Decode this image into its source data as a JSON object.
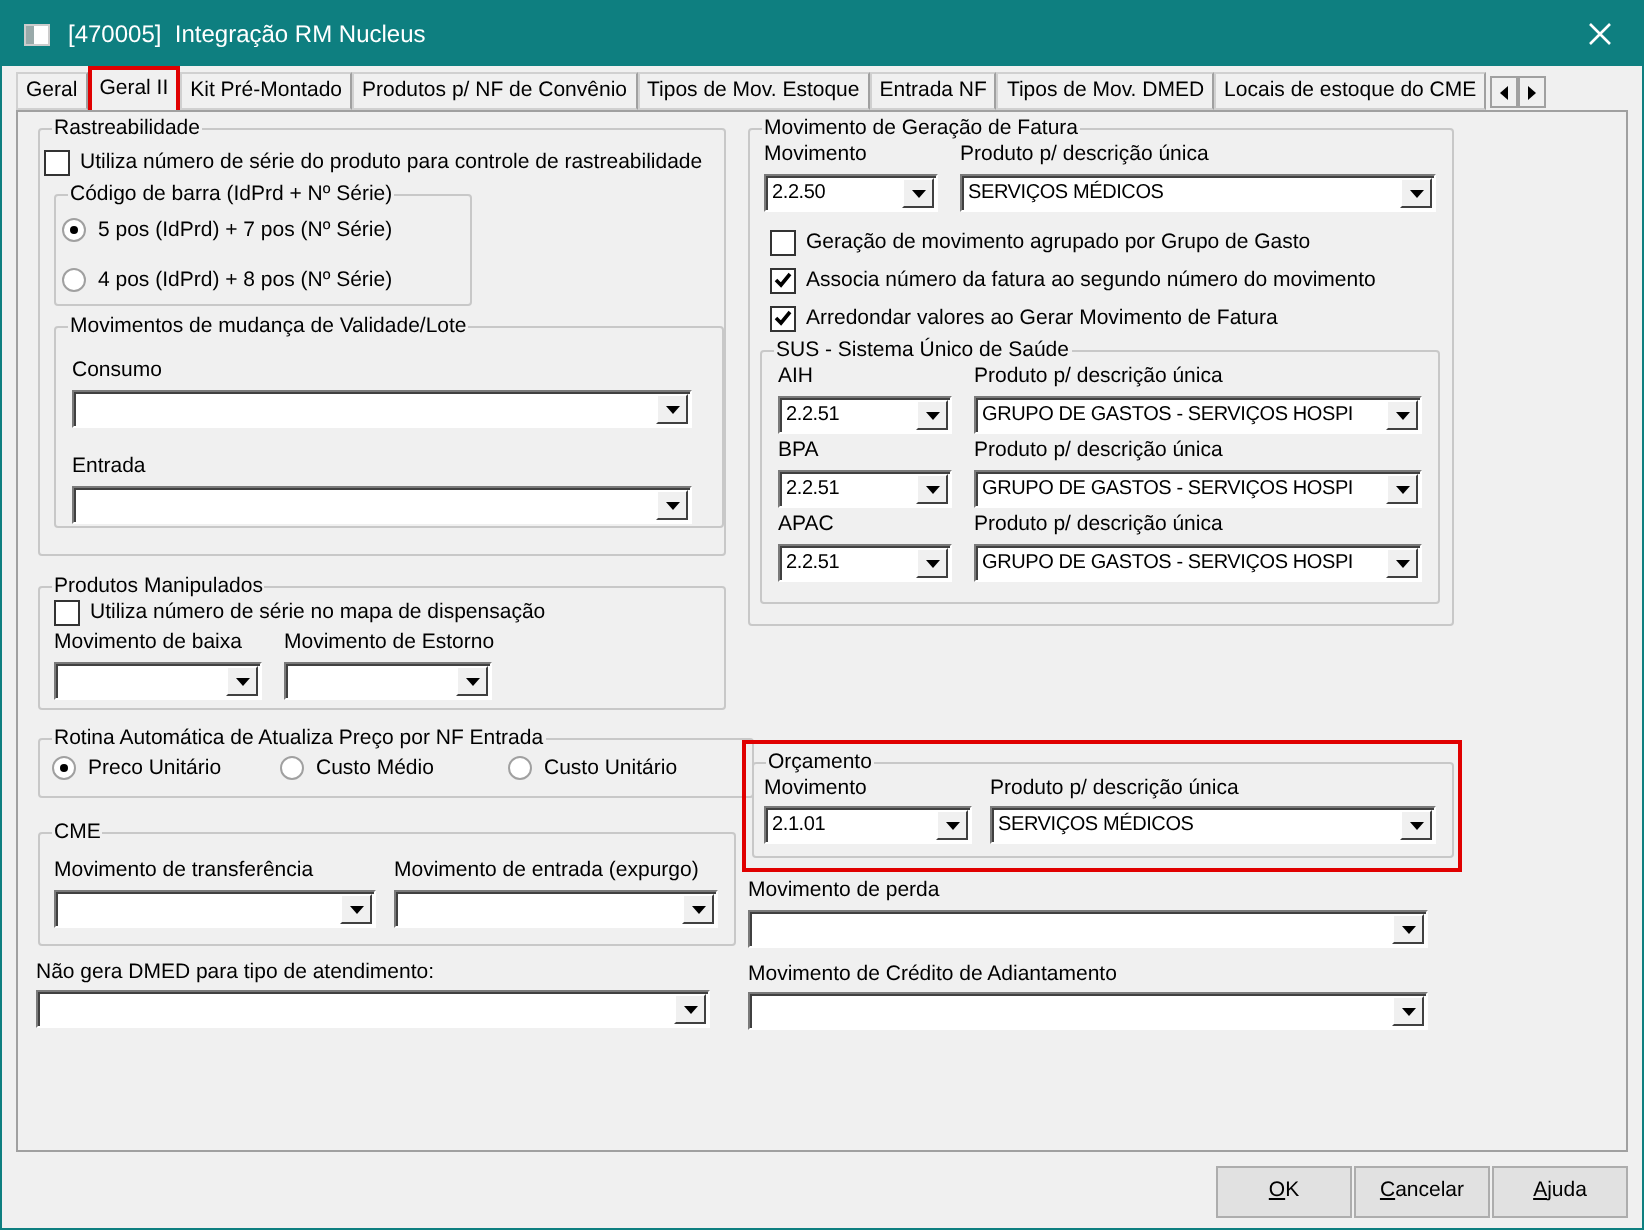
{
  "window": {
    "title": "[470005]  Integração RM Nucleus"
  },
  "tabs": [
    {
      "label": "Geral",
      "selected": false,
      "highlighted": false
    },
    {
      "label": "Geral II",
      "selected": true,
      "highlighted": true
    },
    {
      "label": "Kit Pré-Montado",
      "selected": false,
      "highlighted": false
    },
    {
      "label": "Produtos p/ NF de Convênio",
      "selected": false,
      "highlighted": false
    },
    {
      "label": "Tipos de Mov. Estoque",
      "selected": false,
      "highlighted": false
    },
    {
      "label": "Entrada NF",
      "selected": false,
      "highlighted": false
    },
    {
      "label": "Tipos de Mov. DMED",
      "selected": false,
      "highlighted": false
    },
    {
      "label": "Locais de estoque do CME",
      "selected": false,
      "highlighted": false
    }
  ],
  "rastreabilidade": {
    "title": "Rastreabilidade",
    "serial_checkbox": {
      "label": "Utiliza número de série do produto para controle de rastreabilidade",
      "checked": false
    },
    "barcode": {
      "title": "Código de barra (IdPrd + Nº Série)",
      "options": [
        {
          "label": "5 pos (IdPrd) + 7 pos (Nº Série)",
          "selected": true
        },
        {
          "label": "4 pos (IdPrd) + 8 pos (Nº Série)",
          "selected": false
        }
      ]
    },
    "validade_lote": {
      "title": "Movimentos de mudança de Validade/Lote",
      "fields": [
        {
          "label": "Consumo"
        },
        {
          "label": "Entrada"
        }
      ]
    }
  },
  "produtos_manipulados": {
    "title": "Produtos Manipulados",
    "checkbox": {
      "label": "Utiliza número de série no mapa de dispensação",
      "checked": false
    },
    "fields": [
      {
        "label": "Movimento de baixa"
      },
      {
        "label": "Movimento de Estorno"
      }
    ]
  },
  "rotina": {
    "title": "Rotina Automática de Atualiza Preço por NF Entrada",
    "options": [
      {
        "label": "Preco Unitário",
        "selected": true
      },
      {
        "label": "Custo Médio",
        "selected": false
      },
      {
        "label": "Custo Unitário",
        "selected": false
      }
    ]
  },
  "cme": {
    "title": "CME",
    "fields": [
      {
        "label": "Movimento de transferência"
      },
      {
        "label": "Movimento de entrada (expurgo)"
      }
    ]
  },
  "dmed": {
    "label": "Não gera DMED para tipo de atendimento:"
  },
  "fatura": {
    "title": "Movimento de Geração de Fatura",
    "movimento": {
      "label": "Movimento",
      "value": "2.2.50"
    },
    "produto": {
      "label": "Produto p/ descrição única",
      "value": "SERVIÇOS MÉDICOS"
    },
    "checkboxes": [
      {
        "label": "Geração de movimento agrupado por Grupo de Gasto",
        "checked": false
      },
      {
        "label": "Associa número da fatura ao segundo número do movimento",
        "checked": true
      },
      {
        "label": "Arredondar valores ao Gerar Movimento de Fatura",
        "checked": true
      }
    ],
    "sus": {
      "title": "SUS - Sistema Único de Saúde",
      "rows": [
        {
          "label": "AIH",
          "value": "2.2.51",
          "product_label": "Produto p/ descrição única",
          "product_value": "GRUPO DE GASTOS - SERVIÇOS HOSPI"
        },
        {
          "label": "BPA",
          "value": "2.2.51",
          "product_label": "Produto p/ descrição única",
          "product_value": "GRUPO DE GASTOS - SERVIÇOS HOSPI"
        },
        {
          "label": "APAC",
          "value": "2.2.51",
          "product_label": "Produto p/ descrição única",
          "product_value": "GRUPO DE GASTOS - SERVIÇOS HOSPI"
        }
      ]
    }
  },
  "orcamento": {
    "title": "Orçamento",
    "highlighted": true,
    "movimento": {
      "label": "Movimento",
      "value": "2.1.01"
    },
    "produto": {
      "label": "Produto p/ descrição única",
      "value": "SERVIÇOS MÉDICOS"
    }
  },
  "perda": {
    "label": "Movimento de perda"
  },
  "credito": {
    "label": "Movimento de Crédito de Adiantamento"
  },
  "buttons": [
    "OK",
    "Cancelar",
    "Ajuda"
  ]
}
